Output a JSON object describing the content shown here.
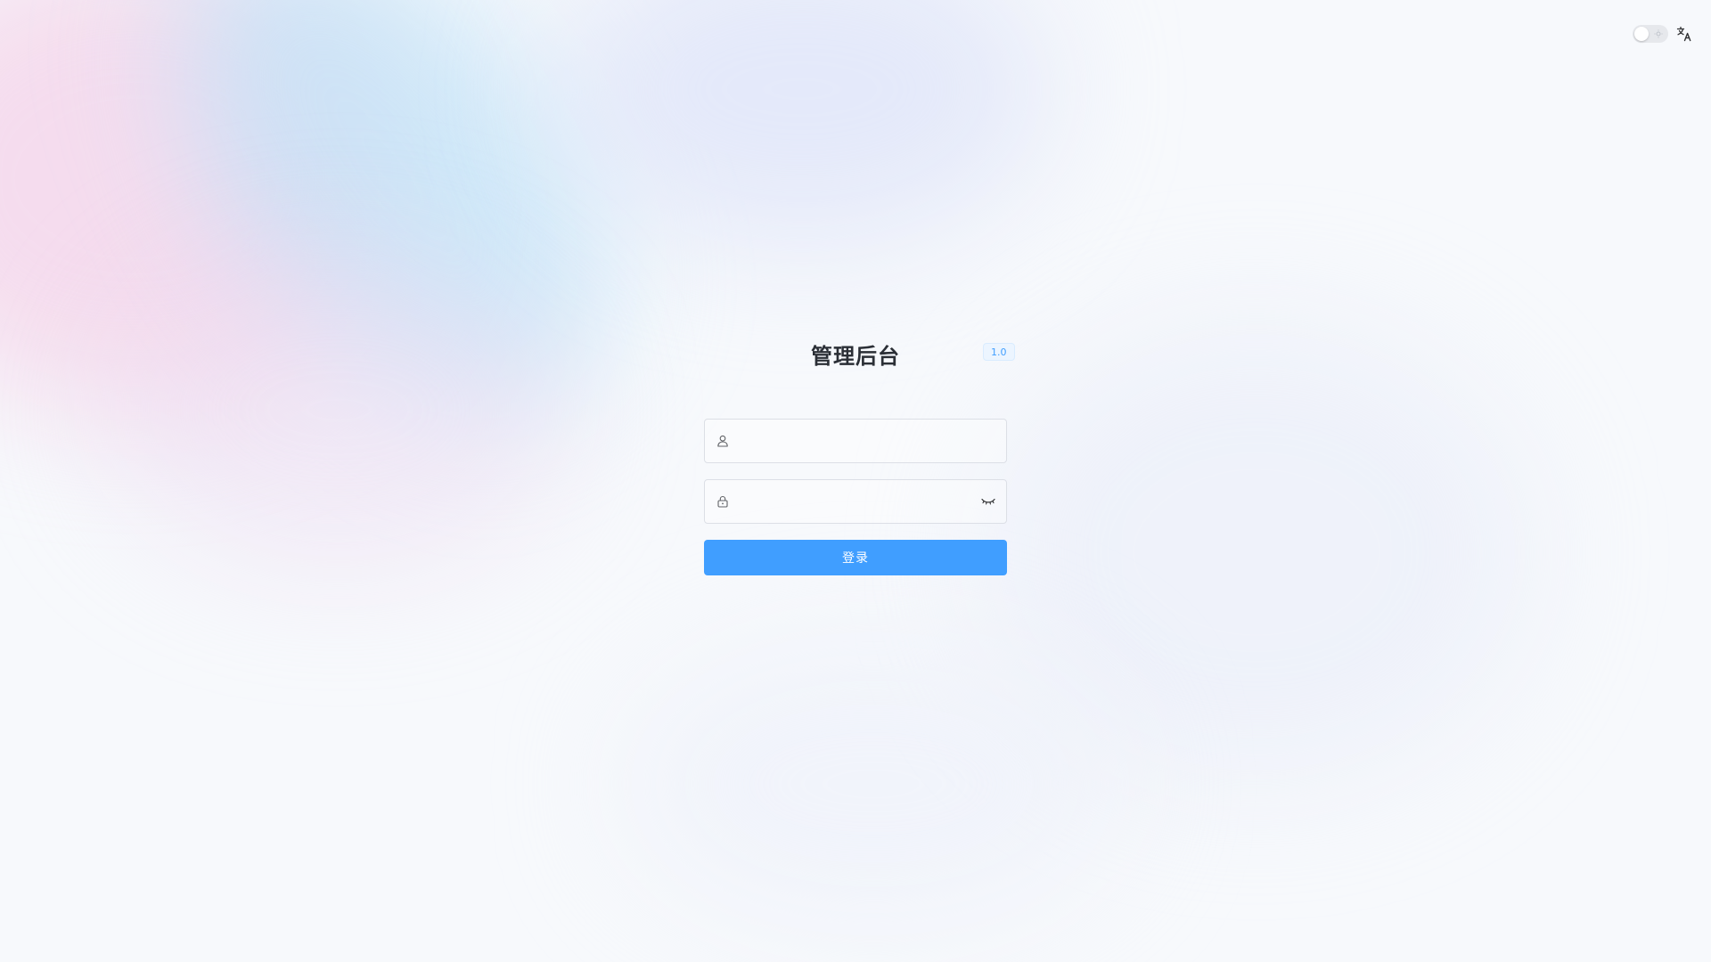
{
  "header": {
    "dark_mode_toggle": "off",
    "language_icon": "translate-icon"
  },
  "login": {
    "title": "管理后台",
    "version": "1.0",
    "username": {
      "icon": "user-icon",
      "value": "",
      "placeholder": ""
    },
    "password": {
      "icon": "lock-icon",
      "value": "",
      "placeholder": "",
      "visibility_icon": "eye-closed-icon"
    },
    "submit_label": "登录"
  },
  "colors": {
    "primary": "#409eff",
    "title": "#2b2f36",
    "border": "#dcdfe6"
  }
}
